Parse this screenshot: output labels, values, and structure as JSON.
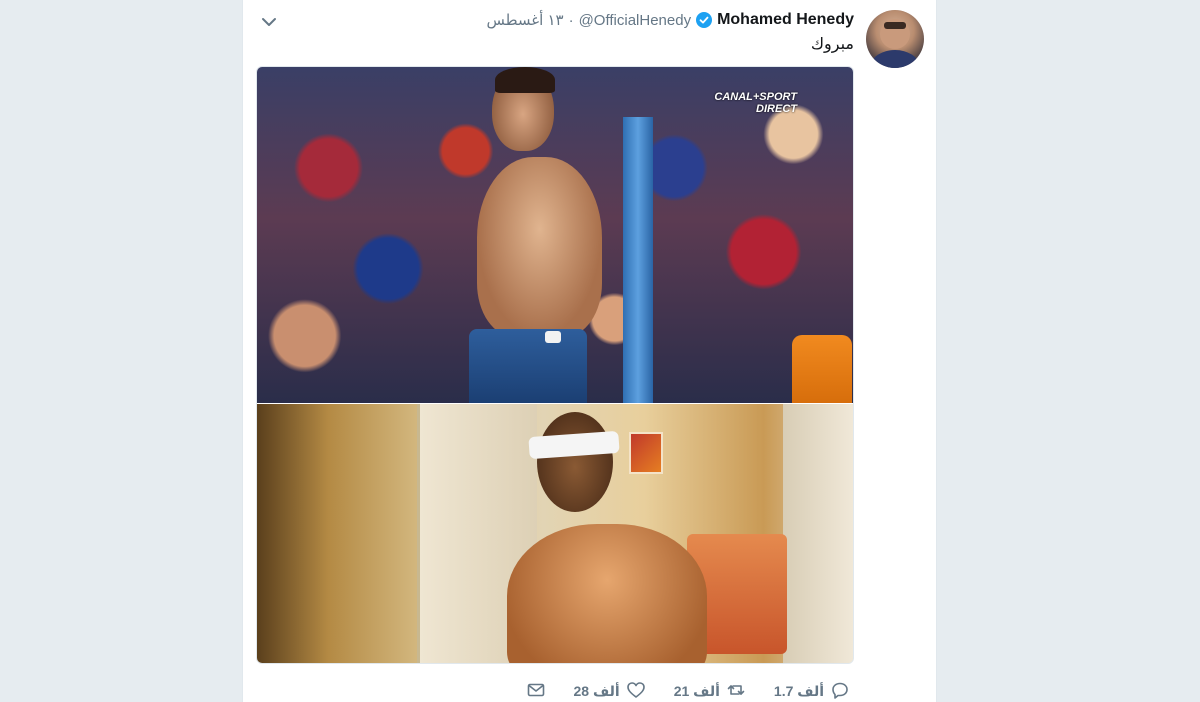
{
  "tweet": {
    "author": {
      "display_name": "Mohamed Henedy",
      "handle": "@OfficialHenedy",
      "verified": true
    },
    "separator": "·",
    "timestamp": "١٣ أغسطس",
    "text": "مبروك",
    "media": {
      "top_photo": {
        "broadcaster_line1": "CANAL+SPORT",
        "broadcaster_line2": "DIRECT"
      }
    },
    "actions": {
      "reply": {
        "count": "1.7 ألف",
        "icon": "reply-icon"
      },
      "retweet": {
        "count": "21 ألف",
        "icon": "retweet-icon"
      },
      "like": {
        "count": "28 ألف",
        "icon": "heart-icon"
      },
      "message": {
        "icon": "envelope-icon"
      }
    },
    "menu_icon": "chevron-down-icon"
  },
  "colors": {
    "page_background": "#e6ecf0",
    "card_background": "#ffffff",
    "secondary_text": "#657786",
    "primary_text": "#14171a",
    "verified_blue": "#1da1f2"
  }
}
